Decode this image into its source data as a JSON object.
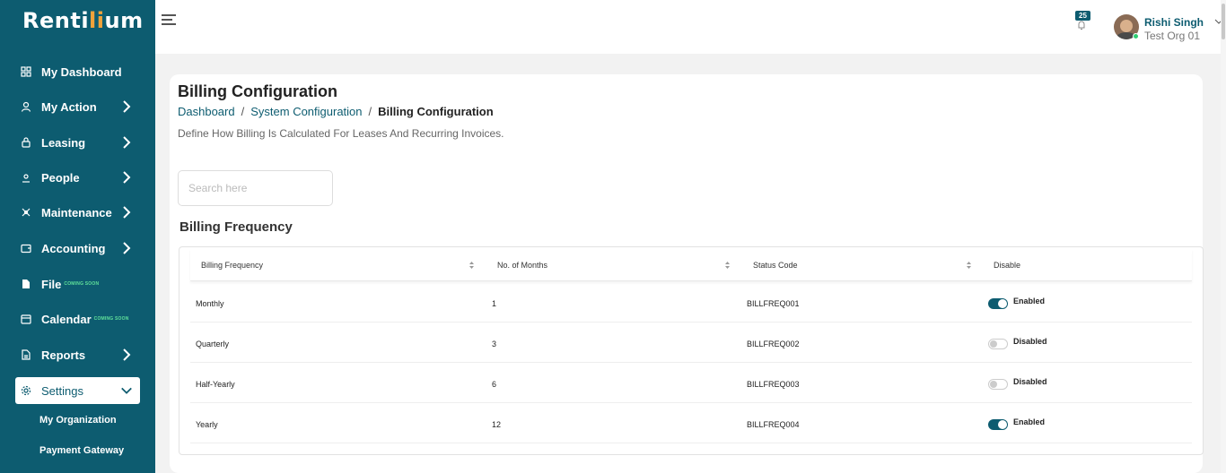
{
  "app": {
    "logo_pre": "Renti",
    "logo_accent": "li",
    "logo_post": "um"
  },
  "sidebar": {
    "items": [
      {
        "label": "My Dashboard"
      },
      {
        "label": "My Action"
      },
      {
        "label": "Leasing"
      },
      {
        "label": "People"
      },
      {
        "label": "Maintenance"
      },
      {
        "label": "Accounting"
      },
      {
        "label": "File",
        "badge": "COMING SOON"
      },
      {
        "label": "Calendar",
        "badge": "COMING SOON"
      },
      {
        "label": "Reports"
      },
      {
        "label": "Settings"
      }
    ],
    "sub_items": [
      {
        "label": "My Organization"
      },
      {
        "label": "Payment Gateway"
      }
    ]
  },
  "header": {
    "notification_count": "25",
    "user_name": "Rishi Singh",
    "user_org": "Test Org 01"
  },
  "page": {
    "title": "Billing Configuration",
    "breadcrumb": [
      "Dashboard",
      "System Configuration",
      "Billing Configuration"
    ],
    "description": "Define How Billing Is Calculated For Leases And Recurring Invoices.",
    "search_placeholder": "Search here",
    "section_title": "Billing Frequency"
  },
  "table": {
    "columns": [
      "Billing Frequency",
      "No. of Months",
      "Status Code",
      "Disable"
    ],
    "rows": [
      {
        "frequency": "Monthly",
        "months": "1",
        "code": "BILLFREQ001",
        "status": "Enabled",
        "enabled": true
      },
      {
        "frequency": "Quarterly",
        "months": "3",
        "code": "BILLFREQ002",
        "status": "Disabled",
        "enabled": false
      },
      {
        "frequency": "Half-Yearly",
        "months": "6",
        "code": "BILLFREQ003",
        "status": "Disabled",
        "enabled": false
      },
      {
        "frequency": "Yearly",
        "months": "12",
        "code": "BILLFREQ004",
        "status": "Enabled",
        "enabled": true
      }
    ]
  },
  "colors": {
    "primary": "#0d5c70",
    "accent": "#f0a23a",
    "coming_soon": "#5fe09a"
  }
}
